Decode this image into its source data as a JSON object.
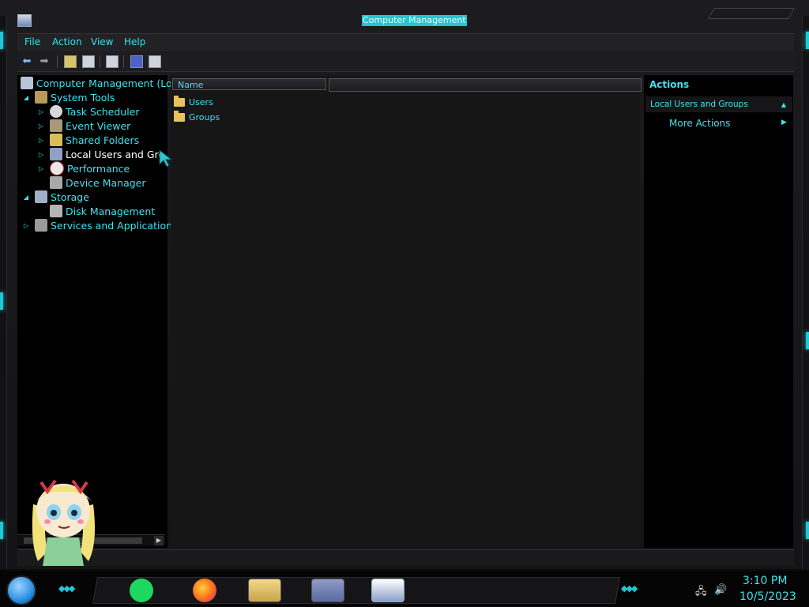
{
  "window": {
    "title": "Computer Management"
  },
  "menu": {
    "items": [
      "File",
      "Action",
      "View",
      "Help"
    ]
  },
  "toolbar": {
    "buttons": [
      "back-icon",
      "forward-icon",
      "up-folder-icon",
      "show-hide-tree-icon",
      "export-list-icon",
      "help-icon",
      "show-hide-action-pane-icon"
    ]
  },
  "tree": {
    "root": "Computer Management (Loc",
    "items": [
      {
        "label": "System Tools",
        "level": 1,
        "expander": "expanded",
        "icon": "tools-icon"
      },
      {
        "label": "Task Scheduler",
        "level": 2,
        "expander": "collapsed",
        "icon": "clock-icon"
      },
      {
        "label": "Event Viewer",
        "level": 2,
        "expander": "collapsed",
        "icon": "event-viewer-icon"
      },
      {
        "label": "Shared Folders",
        "level": 2,
        "expander": "collapsed",
        "icon": "shared-folder-icon"
      },
      {
        "label": "Local Users and Gro",
        "level": 2,
        "expander": "collapsed",
        "icon": "users-icon",
        "selected": true
      },
      {
        "label": "Performance",
        "level": 2,
        "expander": "collapsed",
        "icon": "performance-icon"
      },
      {
        "label": "Device Manager",
        "level": 2,
        "expander": "none",
        "icon": "device-manager-icon"
      },
      {
        "label": "Storage",
        "level": 1,
        "expander": "expanded",
        "icon": "storage-icon"
      },
      {
        "label": "Disk Management",
        "level": 2,
        "expander": "none",
        "icon": "disk-icon"
      },
      {
        "label": "Services and Applications",
        "level": 1,
        "expander": "collapsed",
        "icon": "services-icon"
      }
    ]
  },
  "content": {
    "column_header": "Name",
    "items": [
      "Users",
      "Groups"
    ]
  },
  "actions": {
    "title": "Actions",
    "section": "Local Users and Groups",
    "more": "More Actions"
  },
  "taskbar": {
    "apps": [
      "notes-app-icon",
      "firefox-icon",
      "file-explorer-icon",
      "control-panel-icon",
      "computer-management-icon"
    ],
    "time": "3:10 PM",
    "date": "10/5/2023"
  },
  "colors": {
    "accent": "#3ee3ef",
    "background": "#161617"
  }
}
